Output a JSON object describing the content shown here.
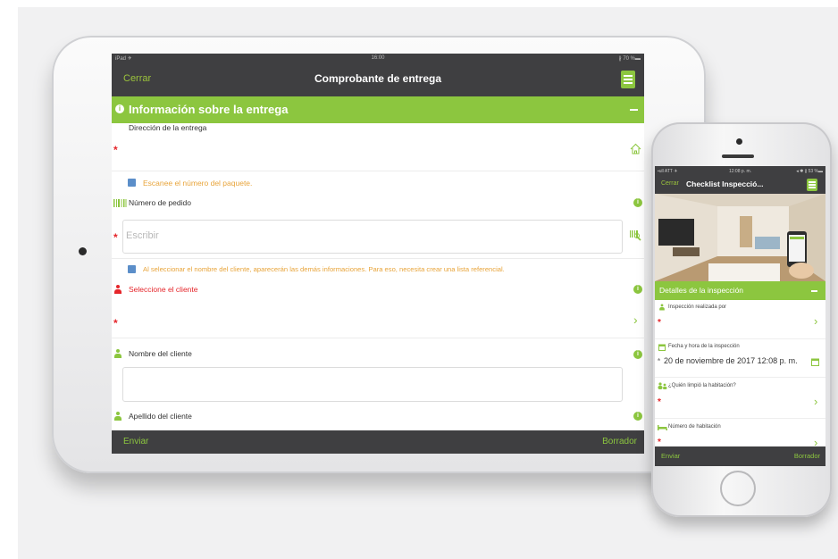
{
  "tablet": {
    "status": {
      "carrier": "iPad ✈",
      "time": "16:00",
      "battery": "∦ 70 %▬"
    },
    "nav": {
      "close": "Cerrar",
      "title": "Comprobante de entrega"
    },
    "section": {
      "icon": "i",
      "title": "Información sobre la entrega"
    },
    "address_label": "Dirección de la entrega",
    "scan_hint": "Escanee el número del paquete.",
    "order_label": "Número de pedido",
    "order_placeholder": "Escribir",
    "client_hint": "Al seleccionar el nombre del cliente, aparecerán las demás informaciones. Para eso, necesita crear una lista referencial.",
    "select_client_label": "Seleccione el cliente",
    "client_name_label": "Nombre del cliente",
    "client_lastname_label": "Apellido del cliente",
    "footer": {
      "send": "Enviar",
      "draft": "Borrador"
    },
    "accent": "#8cc63f",
    "icons": [
      "menu-icon",
      "info-icon",
      "home-icon",
      "barcode-icon",
      "barcode-scan-icon",
      "person-icon",
      "chevron-right-icon"
    ]
  },
  "phone": {
    "status": {
      "carrier": "▪ull ATT ✈",
      "time": "12:08 p. m.",
      "battery": "◂ ✱ ∦ 53 %▬"
    },
    "nav": {
      "close": "Cerrar",
      "title": "Checklist Inspecció..."
    },
    "section_title": "Detalles de la inspección",
    "inspected_by_label": "Inspección realizada por",
    "datetime_label": "Fecha y hora de la inspección",
    "datetime_value": "20 de noviembre de 2017 12:08 p. m.",
    "cleaned_by_label": "¿Quién limpió la habitación?",
    "room_label": "Número de habitación",
    "footer": {
      "send": "Enviar",
      "draft": "Borrador"
    }
  }
}
